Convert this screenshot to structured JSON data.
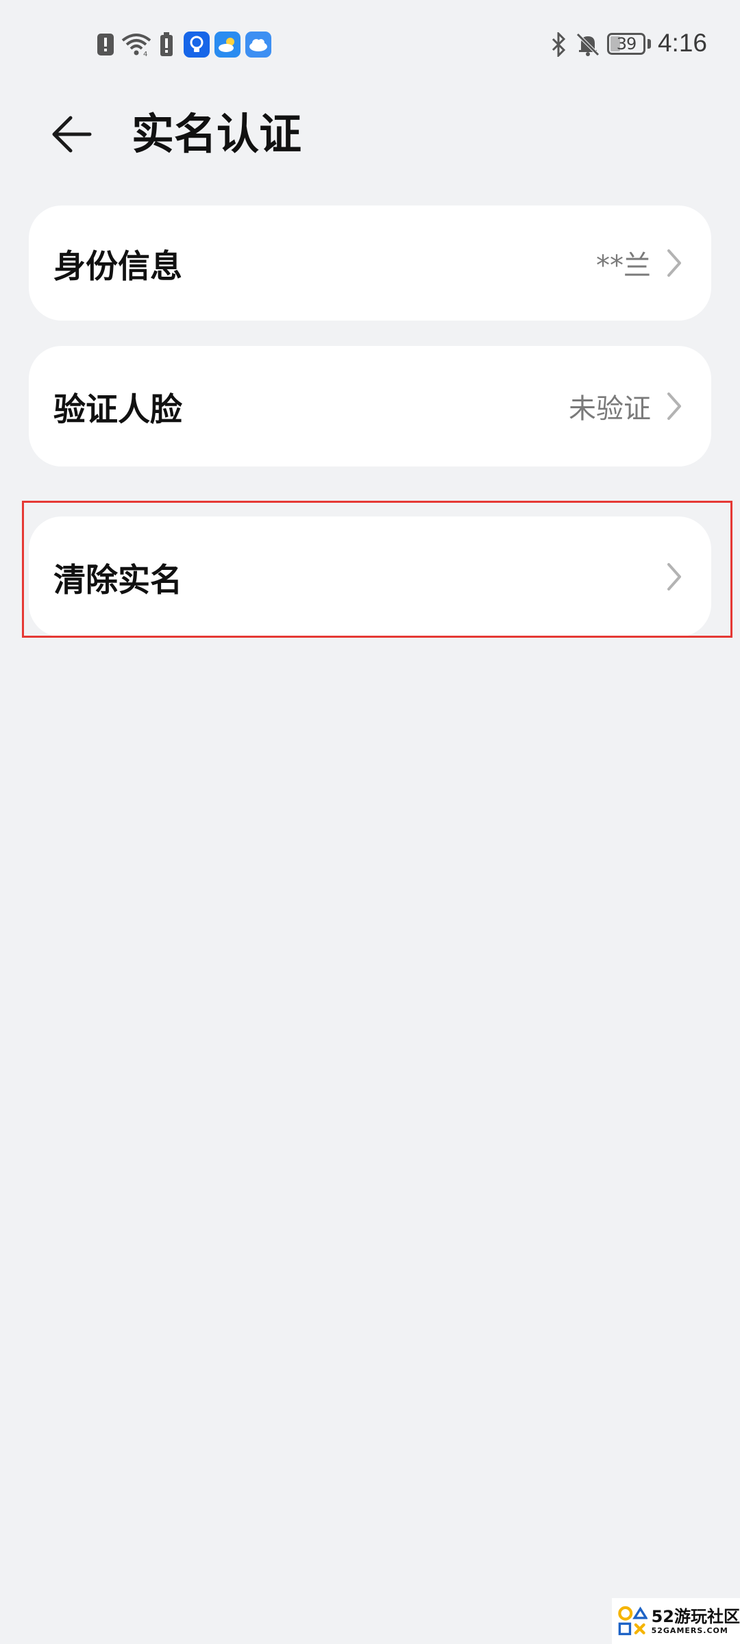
{
  "status_bar": {
    "time": "4:16",
    "battery": "39",
    "icons": [
      "alert-icon",
      "wifi-icon",
      "battery-alert-icon",
      "app-light-icon",
      "weather-app-icon",
      "cloud-app-icon",
      "bluetooth-icon",
      "bell-off-icon"
    ]
  },
  "header": {
    "title": "实名认证",
    "back_icon": "arrow-left-icon"
  },
  "items": [
    {
      "label": "身份信息",
      "value": "**兰"
    },
    {
      "label": "验证人脸",
      "value": "未验证"
    },
    {
      "label": "清除实名",
      "value": ""
    }
  ],
  "highlight": {
    "target": "清除实名",
    "color": "#e53935"
  },
  "watermark": {
    "title": "52游玩社区",
    "subtitle": "52GAMERS.COM"
  },
  "colors": {
    "background": "#f1f2f4",
    "card": "#ffffff",
    "text": "#111111",
    "secondary": "#7a7a7a"
  }
}
